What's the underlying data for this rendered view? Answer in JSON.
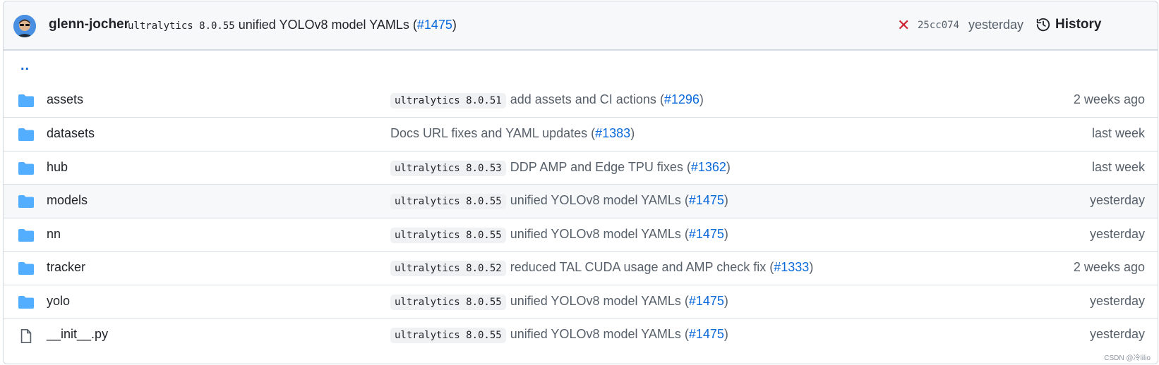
{
  "header": {
    "author": "glenn-jocher",
    "tag": "ultralytics 8.0.55",
    "message_text": "unified YOLOv8 model YAMLs (",
    "message_link": "#1475",
    "message_end": ")",
    "sha": "25cc074",
    "time": "yesterday",
    "history_label": "History"
  },
  "updir": "..",
  "rows": [
    {
      "name": "assets",
      "type": "folder",
      "tag": "ultralytics 8.0.51",
      "msg": "add assets and CI actions (",
      "link": "#1296",
      "end": ")",
      "time": "2 weeks ago"
    },
    {
      "name": "datasets",
      "type": "folder",
      "tag": "",
      "msg": "Docs URL fixes and YAML updates (",
      "link": "#1383",
      "end": ")",
      "time": "last week"
    },
    {
      "name": "hub",
      "type": "folder",
      "tag": "ultralytics 8.0.53",
      "msg": "DDP AMP and Edge TPU fixes (",
      "link": "#1362",
      "end": ")",
      "time": "last week"
    },
    {
      "name": "models",
      "type": "folder",
      "tag": "ultralytics 8.0.55",
      "msg": "unified YOLOv8 model YAMLs (",
      "link": "#1475",
      "end": ")",
      "time": "yesterday"
    },
    {
      "name": "nn",
      "type": "folder",
      "tag": "ultralytics 8.0.55",
      "msg": "unified YOLOv8 model YAMLs (",
      "link": "#1475",
      "end": ")",
      "time": "yesterday"
    },
    {
      "name": "tracker",
      "type": "folder",
      "tag": "ultralytics 8.0.52",
      "msg": "reduced TAL CUDA usage and AMP check fix (",
      "link": "#1333",
      "end": ")",
      "time": "2 weeks ago"
    },
    {
      "name": "yolo",
      "type": "folder",
      "tag": "ultralytics 8.0.55",
      "msg": "unified YOLOv8 model YAMLs (",
      "link": "#1475",
      "end": ")",
      "time": "yesterday"
    },
    {
      "name": "__init__.py",
      "type": "file",
      "tag": "ultralytics 8.0.55",
      "msg": "unified YOLOv8 model YAMLs (",
      "link": "#1475",
      "end": ")",
      "time": "yesterday"
    }
  ],
  "watermark": "CSDN @冷lilio",
  "colors": {
    "link": "#0969da",
    "folder": "#54aeff",
    "fail": "#cf222e"
  }
}
